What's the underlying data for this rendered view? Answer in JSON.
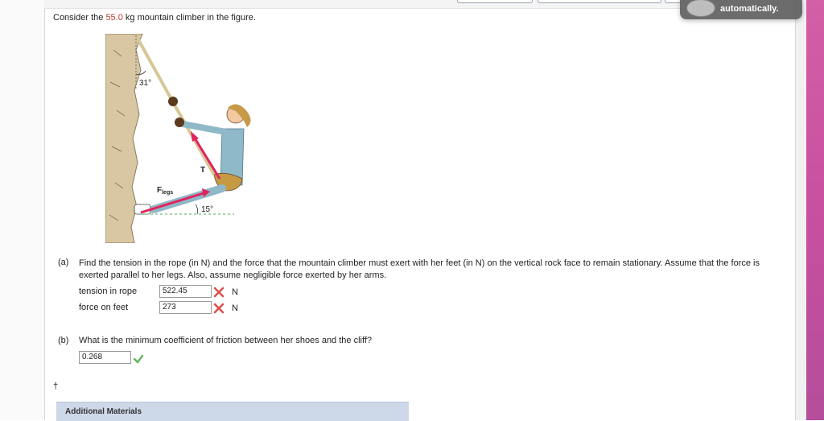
{
  "toast": {
    "text": "automatically."
  },
  "problem": {
    "prompt_before": "Consider the ",
    "mass_value": "55.0",
    "prompt_after": " kg mountain climber in the figure."
  },
  "figure": {
    "angle_top": "31°",
    "angle_bottom": "15°",
    "tension_label": "T",
    "force_label_main": "F",
    "force_label_sub": "legs"
  },
  "part_a": {
    "label": "(a)",
    "text": "Find the tension in the rope (in N) and the force that the mountain climber must exert with her feet (in N) on the vertical rock face to remain stationary. Assume that the force is exerted parallel to her legs. Also, assume negligible force exerted by her arms.",
    "rows": [
      {
        "label": "tension in rope",
        "value": "522.45",
        "unit": "N"
      },
      {
        "label": "force on feet",
        "value": "273",
        "unit": "N"
      }
    ]
  },
  "part_b": {
    "label": "(b)",
    "text": "What is the minimum coefficient of friction between her shoes and the cliff?",
    "value": "0.268"
  },
  "footnote": {
    "dagger": "†"
  },
  "additional": {
    "label": "Additional Materials"
  },
  "colors": {
    "mass_red": "#c0392b",
    "wrong_red": "#d9534f",
    "correct_green": "#5cb85c",
    "arrow_red": "#e0245e",
    "additional_bg": "#cdd8e8"
  }
}
